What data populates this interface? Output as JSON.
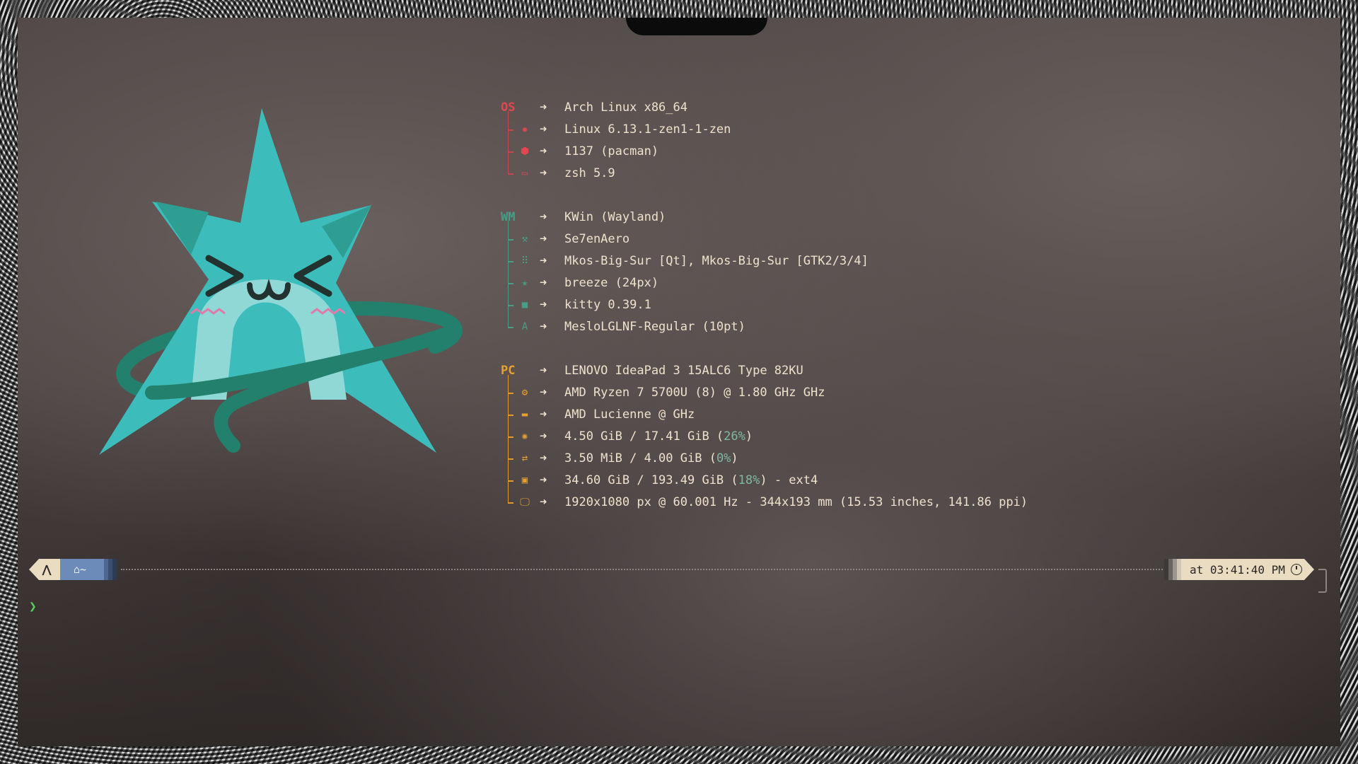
{
  "colors": {
    "os_accent": "#e0474f",
    "wm_accent": "#4a9c86",
    "pc_accent": "#e6a12f",
    "text": "#efe2cc",
    "percent": "#7fb8a2",
    "logo_teal": "#3dbcbc",
    "logo_dark": "#22806c",
    "prompt_green": "#52d352"
  },
  "arrow": "➜",
  "os": {
    "key": "OS",
    "value": "Arch Linux x86_64",
    "items": [
      {
        "icon": "gear-icon",
        "glyph": "✹",
        "value": "Linux 6.13.1-zen1-1-zen"
      },
      {
        "icon": "package-icon",
        "glyph": "⬢",
        "value": "1137 (pacman)"
      },
      {
        "icon": "terminal-icon",
        "glyph": "▭",
        "value": "zsh 5.9"
      }
    ]
  },
  "wm": {
    "key": "WM",
    "value": "KWin (Wayland)",
    "items": [
      {
        "icon": "paint-roller-icon",
        "glyph": "⚒",
        "value": "Se7enAero"
      },
      {
        "icon": "grid-icon",
        "glyph": "⠿",
        "value": "Mkos-Big-Sur [Qt], Mkos-Big-Sur [GTK2/3/4]"
      },
      {
        "icon": "star-icon",
        "glyph": "★",
        "value": "breeze (24px)"
      },
      {
        "icon": "window-icon",
        "glyph": "■",
        "value": "kitty 0.39.1"
      },
      {
        "icon": "font-icon",
        "glyph": "A",
        "value": "MesloLGLNF-Regular (10pt)"
      }
    ]
  },
  "pc": {
    "key": "PC",
    "value": "LENOVO IdeaPad 3 15ALC6 Type 82KU",
    "cpu": {
      "icon": "cpu-icon",
      "glyph": "⚙",
      "value": "AMD Ryzen 7 5700U (8) @ 1.80 GHz GHz"
    },
    "gpu": {
      "icon": "gpu-icon",
      "glyph": "▬",
      "value": "AMD Lucienne @  GHz"
    },
    "memory": {
      "icon": "memory-icon",
      "glyph": "✺",
      "pre": "4.50 GiB / 17.41 GiB (",
      "pct": "26%",
      "post": ")"
    },
    "swap": {
      "icon": "swap-icon",
      "glyph": "⇄",
      "pre": "3.50 MiB / 4.00 GiB (",
      "pct": "0%",
      "post": ")"
    },
    "disk": {
      "icon": "disk-icon",
      "glyph": "▣",
      "pre": "34.60 GiB / 193.49 GiB (",
      "pct": "18%",
      "post": ") - ext4"
    },
    "display": {
      "icon": "monitor-icon",
      "glyph": "🖵",
      "value": "1920x1080 px @ 60.001 Hz - 344x193 mm (15.53 inches, 141.86 ppi)"
    }
  },
  "prompt": {
    "os_glyph": "⋀",
    "home_glyph": "⌂",
    "cwd": "~",
    "time_text": "at 03:41:40 PM",
    "cursor": "❯"
  }
}
